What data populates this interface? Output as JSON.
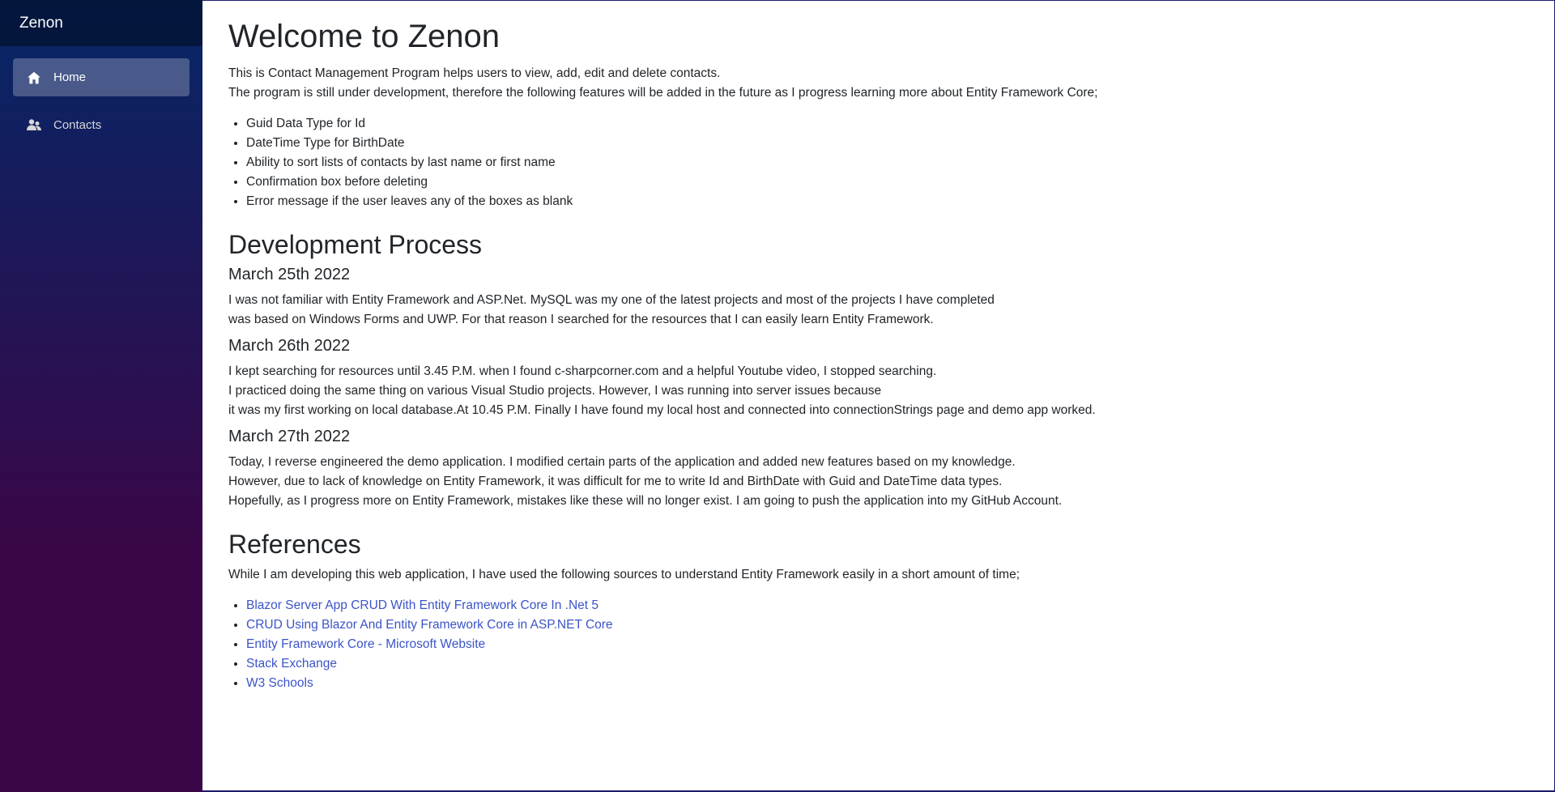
{
  "brand": "Zenon",
  "nav": [
    {
      "label": "Home",
      "icon": "home-icon",
      "active": true
    },
    {
      "label": "Contacts",
      "icon": "people-icon",
      "active": false
    }
  ],
  "main": {
    "title": "Welcome to Zenon",
    "intro": [
      "This is Contact Management Program helps users to view, add, edit and delete contacts.",
      "The program is still under development, therefore the following features will be added in the future as I progress learning more about Entity Framework Core;"
    ],
    "features": [
      "Guid Data Type for Id",
      "DateTime Type for BirthDate",
      "Ability to sort lists of contacts by last name or first name",
      "Confirmation box before deleting",
      "Error message if the user leaves any of the boxes as blank"
    ],
    "dev_title": "Development Process",
    "dev_entries": [
      {
        "date": "March 25th 2022",
        "lines": [
          "I was not familiar with Entity Framework and ASP.Net. MySQL was my one of the latest projects and most of the projects I have completed",
          "was based on Windows Forms and UWP. For that reason I searched for the resources that I can easily learn Entity Framework."
        ]
      },
      {
        "date": "March 26th 2022",
        "lines": [
          "I kept searching for resources until 3.45 P.M. when I found c-sharpcorner.com and a helpful Youtube video, I stopped searching.",
          "I practiced doing the same thing on various Visual Studio projects. However, I was running into server issues because",
          "it was my first working on local database.At 10.45 P.M. Finally I have found my local host and connected into connectionStrings page and demo app worked."
        ]
      },
      {
        "date": "March 27th 2022",
        "lines": [
          "Today, I reverse engineered the demo application. I modified certain parts of the application and added new features based on my knowledge.",
          "However, due to lack of knowledge on Entity Framework, it was difficult for me to write Id and BirthDate with Guid and DateTime data types.",
          "Hopefully, as I progress more on Entity Framework, mistakes like these will no longer exist. I am going to push the application into my GitHub Account."
        ]
      }
    ],
    "ref_title": "References",
    "ref_intro": "While I am developing this web application, I have used the following sources to understand Entity Framework easily in a short amount of time;",
    "references": [
      "Blazor Server App CRUD With Entity Framework Core In .Net 5",
      "CRUD Using Blazor And Entity Framework Core in ASP.NET Core",
      "Entity Framework Core - Microsoft Website",
      "Stack Exchange",
      "W3 Schools"
    ]
  },
  "colors": {
    "link": "#3b54c7",
    "sidebar_top": "#052767",
    "sidebar_bottom": "#3a0647",
    "frame_border": "#1b1b6b"
  }
}
